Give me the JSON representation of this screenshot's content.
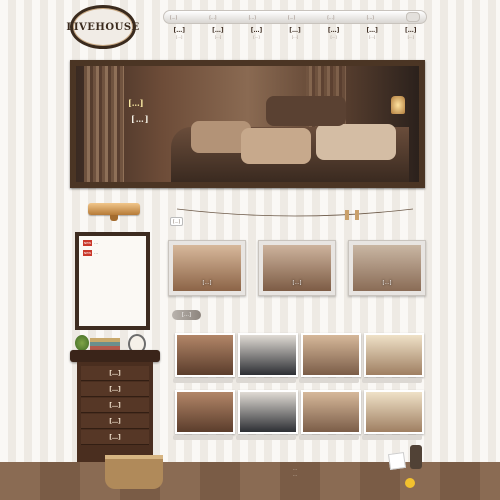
{
  "site": {
    "logo": "LIVEHOUSE"
  },
  "note": "Small text not legible at this resolution; '[…]' marks unread labels and '…' unread body text.",
  "topbar": {
    "links": [
      "[…]",
      "[…]",
      "[…]",
      "[…]",
      "[…]",
      "[…]"
    ],
    "search_icon": "search-icon"
  },
  "nav": [
    {
      "zh": "[…]",
      "en": "[…]"
    },
    {
      "zh": "[…]",
      "en": "[…]"
    },
    {
      "zh": "[…]",
      "en": "[…]"
    },
    {
      "zh": "[…]",
      "en": "[…]"
    },
    {
      "zh": "[…]",
      "en": "[…]"
    },
    {
      "zh": "[…]",
      "en": "[…]"
    },
    {
      "zh": "[…]",
      "en": "[…]"
    }
  ],
  "hero": {
    "title": "[…]",
    "subtitle": "[…]"
  },
  "clothesline": {
    "label": "[…]"
  },
  "notice": {
    "badge": "NEW",
    "items": [
      "…",
      "…"
    ]
  },
  "featured": [
    {
      "caption": "[…]"
    },
    {
      "caption": "[…]"
    },
    {
      "caption": "[…]"
    }
  ],
  "new_products": {
    "label": "[…]"
  },
  "cabinet_menu": [
    "[…]",
    "[…]",
    "[…]",
    "[…]",
    "[…]"
  ],
  "footer": {
    "lines": [
      "…",
      "…"
    ]
  }
}
